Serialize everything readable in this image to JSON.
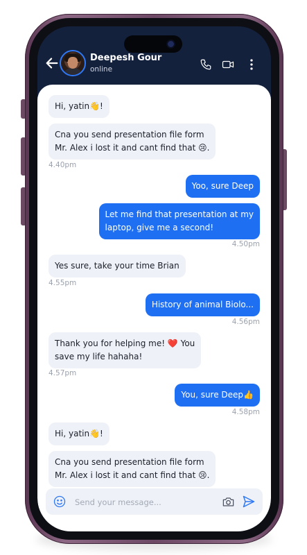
{
  "header": {
    "contact_name": "Deepesh Gour",
    "status": "online",
    "icons": {
      "back": "arrow-left-icon",
      "call": "phone-icon",
      "video": "video-camera-icon",
      "menu": "more-vertical-icon"
    }
  },
  "messages": [
    {
      "dir": "in",
      "text": "Hi, yatin👋!",
      "time": ""
    },
    {
      "dir": "in",
      "text": "Cna you send presentation file form\nMr. Alex i lost it and cant find that 😢.",
      "time": "4.40pm"
    },
    {
      "dir": "out",
      "text": "Yoo, sure Deep",
      "time": ""
    },
    {
      "dir": "out",
      "text": "Let me find that presentation at my\nlaptop, give me a second!",
      "time": "4.50pm"
    },
    {
      "dir": "in",
      "text": "Yes sure, take your time Brian",
      "time": "4.55pm"
    },
    {
      "dir": "out",
      "text": "History of animal Biolo...",
      "time": "4.56pm"
    },
    {
      "dir": "in",
      "text": "Thank you for helping me! ❤️ You\nsave my life hahaha!",
      "time": "4.57pm"
    },
    {
      "dir": "out",
      "text": "You, sure Deep👍",
      "time": "4.58pm"
    },
    {
      "dir": "in",
      "text": "Hi, yatin👋!",
      "time": ""
    },
    {
      "dir": "in",
      "text": "Cna you send presentation file form\nMr. Alex i lost it and cant find that 😢.",
      "time": ""
    }
  ],
  "composer": {
    "placeholder": "Send your message...",
    "icons": {
      "emoji": "smiley-icon",
      "camera": "camera-icon",
      "send": "send-icon"
    }
  },
  "colors": {
    "header_bg": "#14213d",
    "outgoing_bubble": "#1f6ff2",
    "incoming_bubble": "#eef1f7",
    "accent": "#2f79f6",
    "phone_frame": "#7a566f"
  }
}
